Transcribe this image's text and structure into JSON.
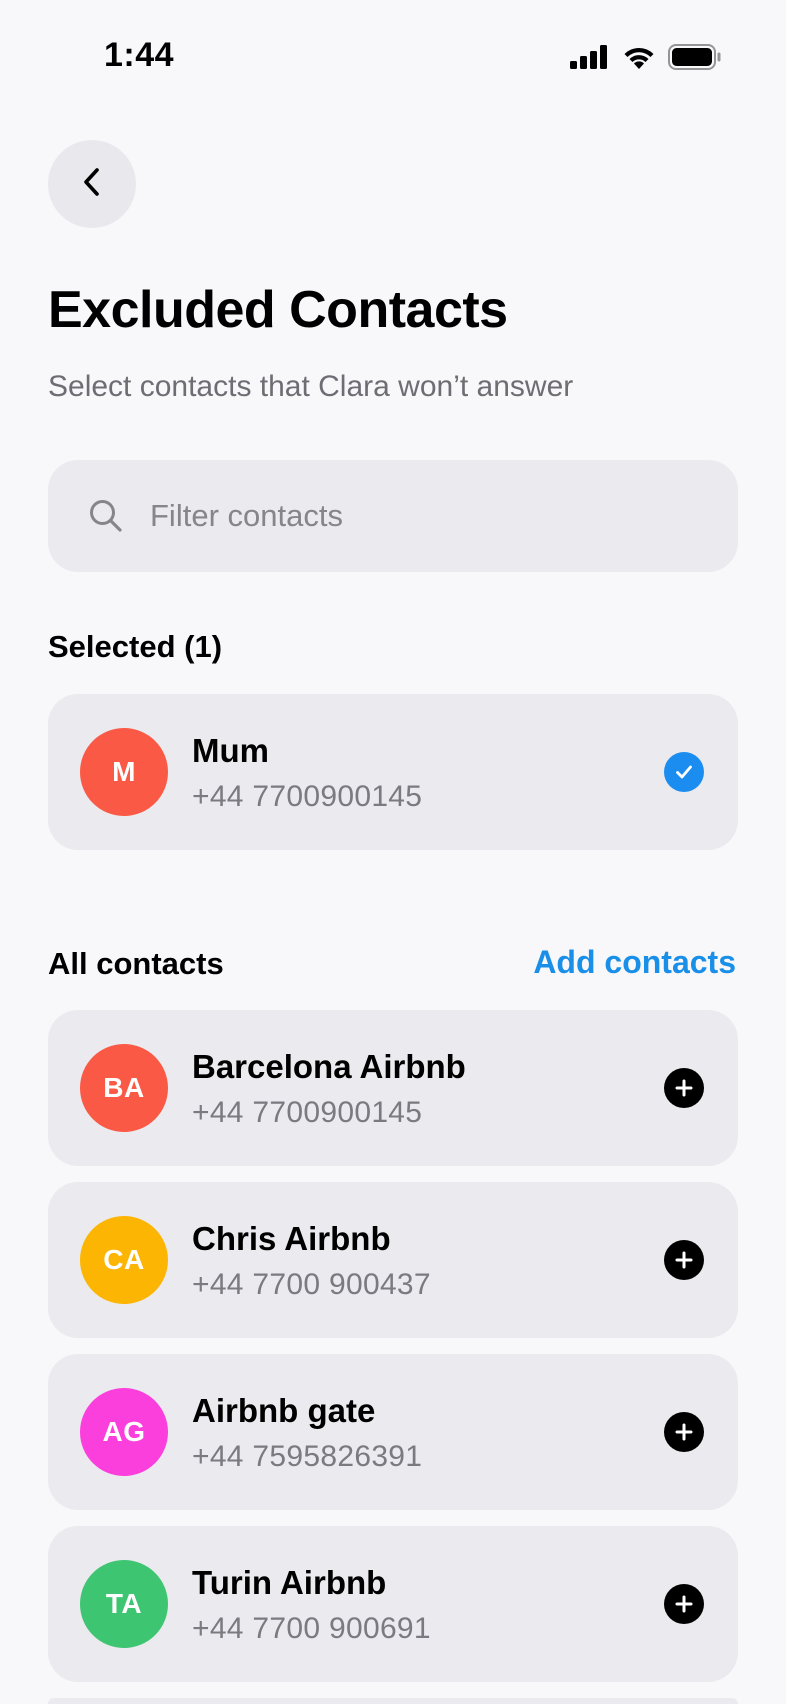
{
  "status_bar": {
    "time": "1:44",
    "icons": [
      "cellular-signal-icon",
      "wifi-icon",
      "battery-icon"
    ]
  },
  "header": {
    "back_icon": "chevron-left-icon",
    "title": "Excluded Contacts",
    "subtitle": "Select contacts that Clara won’t answer"
  },
  "search": {
    "placeholder": "Filter contacts",
    "value": "",
    "icon": "search-icon"
  },
  "selected_section": {
    "heading": "Selected (1)",
    "contacts": [
      {
        "initials": "M",
        "name": "Mum",
        "phone": "+44 7700900145",
        "avatar_color": "#fa5a45",
        "action_icon": "checkmark-circle-icon"
      }
    ]
  },
  "all_section": {
    "heading": "All contacts",
    "add_label": "Add contacts",
    "contacts": [
      {
        "initials": "BA",
        "name": "Barcelona Airbnb",
        "phone": "+44 7700900145",
        "avatar_color": "#fa5a45",
        "action_icon": "plus-circle-icon"
      },
      {
        "initials": "CA",
        "name": "Chris Airbnb",
        "phone": "+44 7700 900437",
        "avatar_color": "#fdb503",
        "action_icon": "plus-circle-icon"
      },
      {
        "initials": "AG",
        "name": "Airbnb gate",
        "phone": "+44 7595826391",
        "avatar_color": "#fb3fdc",
        "action_icon": "plus-circle-icon"
      },
      {
        "initials": "TA",
        "name": "Turin Airbnb",
        "phone": "+44 7700 900691",
        "avatar_color": "#3ec572",
        "action_icon": "plus-circle-icon"
      }
    ]
  },
  "colors": {
    "background": "#f8f7fa",
    "card": "#ebeaee",
    "accent_blue": "#1a8fe8",
    "secondary_text": "#6e6d73"
  }
}
